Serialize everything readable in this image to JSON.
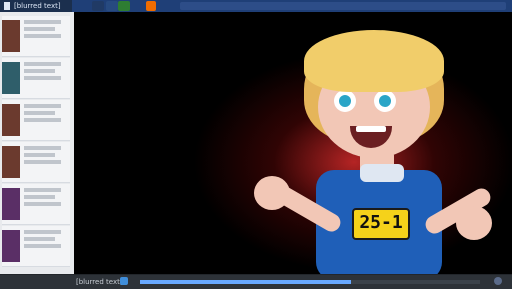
{
  "window": {
    "file_title": "[blurred text]",
    "tabs": [
      "",
      "",
      "",
      ""
    ]
  },
  "sidebar": {
    "items": [
      {
        "thumb": "thumb-portrait",
        "lines": [
          "",
          ""
        ]
      },
      {
        "thumb": "thumb-portrait",
        "lines": [
          "",
          ""
        ]
      },
      {
        "thumb": "thumb-portrait",
        "lines": [
          "",
          ""
        ]
      },
      {
        "thumb": "thumb-portrait",
        "lines": [
          "",
          ""
        ]
      },
      {
        "thumb": "thumb-portrait",
        "lines": [
          "",
          ""
        ]
      },
      {
        "thumb": "thumb-portrait",
        "lines": [
          "",
          ""
        ]
      }
    ]
  },
  "viewer": {
    "image_label": "",
    "bib_number": "25-1"
  },
  "status": {
    "counter": "[blurred text]",
    "progress": 0.62
  },
  "colors": {
    "accent": "#3f8dd9",
    "background": "#000000",
    "glow": "#c82828"
  }
}
